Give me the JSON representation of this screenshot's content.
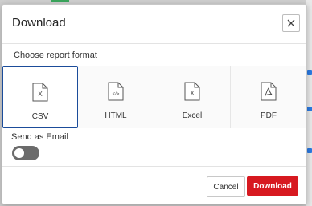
{
  "dialog": {
    "title": "Download",
    "close_icon": "close-icon"
  },
  "format_section": {
    "label": "Choose report format",
    "selected": "CSV",
    "formats": [
      {
        "label": "CSV",
        "icon": "csv-file-icon",
        "glyph": "X"
      },
      {
        "label": "HTML",
        "icon": "html-file-icon",
        "glyph": "</>"
      },
      {
        "label": "Excel",
        "icon": "excel-file-icon",
        "glyph": "X"
      },
      {
        "label": "PDF",
        "icon": "pdf-file-icon",
        "glyph": "pdf"
      }
    ]
  },
  "email": {
    "label": "Send as Email",
    "enabled": false
  },
  "footer": {
    "cancel_label": "Cancel",
    "download_label": "Download"
  },
  "colors": {
    "accent_red": "#d71920",
    "selected_border": "#1b4c9a",
    "toggle_off": "#6b6b6b"
  }
}
